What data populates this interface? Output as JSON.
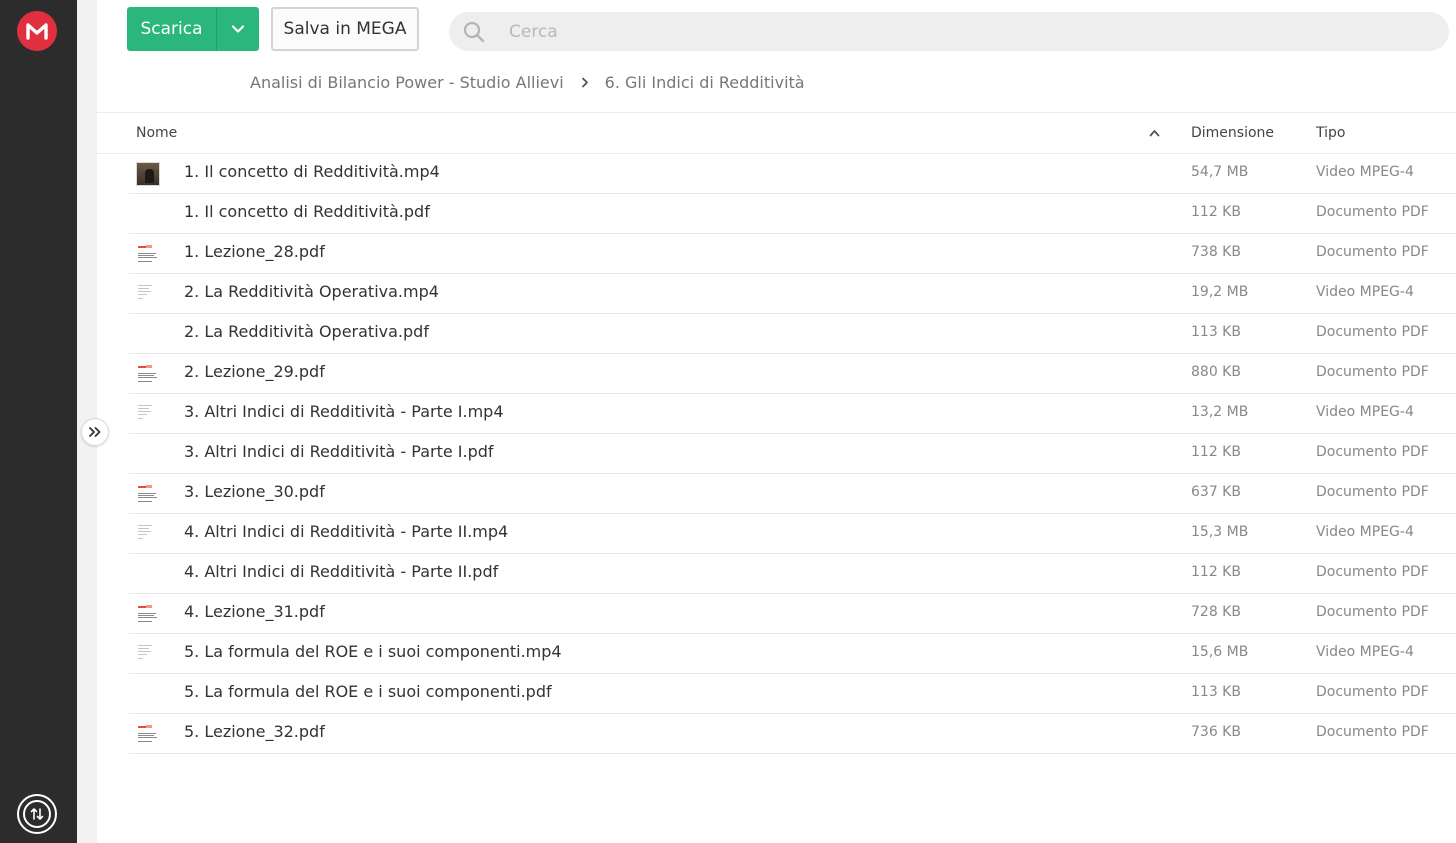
{
  "app": {
    "colors": {
      "sidebar": "#2c2c2c",
      "logo": "#e03040",
      "download_button": "#2bb67c",
      "search_bg": "#eeeeee"
    }
  },
  "toolbar": {
    "download_label": "Scarica",
    "save_label": "Salva in MEGA",
    "search_placeholder": "Cerca"
  },
  "breadcrumb": {
    "items": [
      {
        "label": "Analisi di Bilancio Power - Studio Allievi"
      },
      {
        "label": "6. Gli Indici di Redditività"
      }
    ]
  },
  "table": {
    "columns": {
      "name": "Nome",
      "size": "Dimensione",
      "type": "Tipo"
    },
    "sort": {
      "column": "Nome",
      "direction": "ascending"
    },
    "rows": [
      {
        "name": "1. Il concetto di Redditività.mp4",
        "size": "54,7 MB",
        "type": "Video MPEG-4",
        "thumb": "video"
      },
      {
        "name": "1. Il concetto di Redditività.pdf",
        "size": "112 KB",
        "type": "Documento PDF",
        "thumb": "none"
      },
      {
        "name": "1. Lezione_28.pdf",
        "size": "738 KB",
        "type": "Documento PDF",
        "thumb": "doc"
      },
      {
        "name": "2. La Redditività Operativa.mp4",
        "size": "19,2 MB",
        "type": "Video MPEG-4",
        "thumb": "slide"
      },
      {
        "name": "2. La Redditività Operativa.pdf",
        "size": "113 KB",
        "type": "Documento PDF",
        "thumb": "none"
      },
      {
        "name": "2. Lezione_29.pdf",
        "size": "880 KB",
        "type": "Documento PDF",
        "thumb": "doc"
      },
      {
        "name": "3. Altri Indici di Redditività - Parte I.mp4",
        "size": "13,2 MB",
        "type": "Video MPEG-4",
        "thumb": "slide"
      },
      {
        "name": "3. Altri Indici di Redditività - Parte I.pdf",
        "size": "112 KB",
        "type": "Documento PDF",
        "thumb": "none"
      },
      {
        "name": "3. Lezione_30.pdf",
        "size": "637 KB",
        "type": "Documento PDF",
        "thumb": "doc"
      },
      {
        "name": "4. Altri Indici di Redditività - Parte II.mp4",
        "size": "15,3 MB",
        "type": "Video MPEG-4",
        "thumb": "slide"
      },
      {
        "name": "4. Altri Indici di Redditività - Parte II.pdf",
        "size": "112 KB",
        "type": "Documento PDF",
        "thumb": "none"
      },
      {
        "name": "4. Lezione_31.pdf",
        "size": "728 KB",
        "type": "Documento PDF",
        "thumb": "doc"
      },
      {
        "name": "5. La formula del ROE e i suoi componenti.mp4",
        "size": "15,6 MB",
        "type": "Video MPEG-4",
        "thumb": "slide"
      },
      {
        "name": "5. La formula del ROE e i suoi componenti.pdf",
        "size": "113 KB",
        "type": "Documento PDF",
        "thumb": "none"
      },
      {
        "name": "5. Lezione_32.pdf",
        "size": "736 KB",
        "type": "Documento PDF",
        "thumb": "doc"
      }
    ]
  }
}
